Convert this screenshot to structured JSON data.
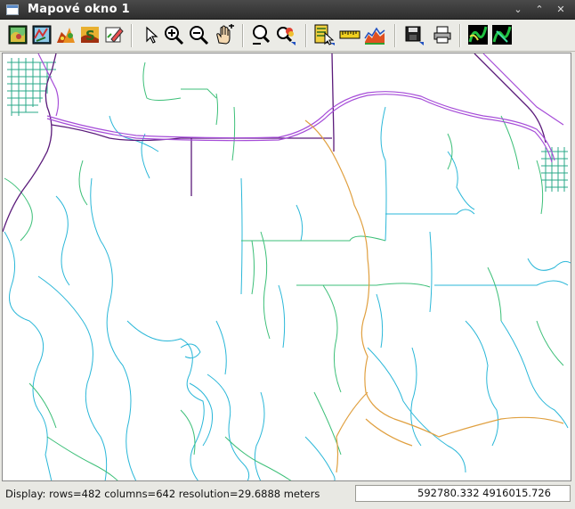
{
  "window": {
    "title": "Mapové okno 1",
    "controls": {
      "minimize": "⌄",
      "maximize": "⌃",
      "close": "✕"
    }
  },
  "toolbar": {
    "buttons": [
      {
        "name": "add-raster-map-icon"
      },
      {
        "name": "add-vector-map-icon"
      },
      {
        "name": "add-3d-map-icon"
      },
      {
        "name": "add-text-map-icon"
      },
      {
        "name": "erase-display-icon"
      },
      {
        "name": "pointer-icon"
      },
      {
        "name": "zoom-in-icon"
      },
      {
        "name": "zoom-out-icon"
      },
      {
        "name": "pan-hand-icon"
      },
      {
        "name": "zoom-back-icon"
      },
      {
        "name": "zoom-options-icon"
      },
      {
        "name": "query-icon"
      },
      {
        "name": "measure-ruler-icon"
      },
      {
        "name": "profile-icon"
      },
      {
        "name": "save-icon"
      },
      {
        "name": "print-icon"
      },
      {
        "name": "nviz-3d-icon"
      },
      {
        "name": "nviz-3d-alt-icon"
      }
    ]
  },
  "map": {
    "colors": {
      "background": "#ffffff",
      "highway": "#a64dd8",
      "road_major": "#5a1a7a",
      "road_route": "#e0a040",
      "stream_cyan": "#2ab7d8",
      "stream_green": "#3cbf78",
      "town_grid": "#2aa888"
    }
  },
  "status": {
    "display_text": "Display: rows=482 columns=642  resolution=29.6888 meters",
    "coordinates": "592780.332 4916015.726"
  }
}
